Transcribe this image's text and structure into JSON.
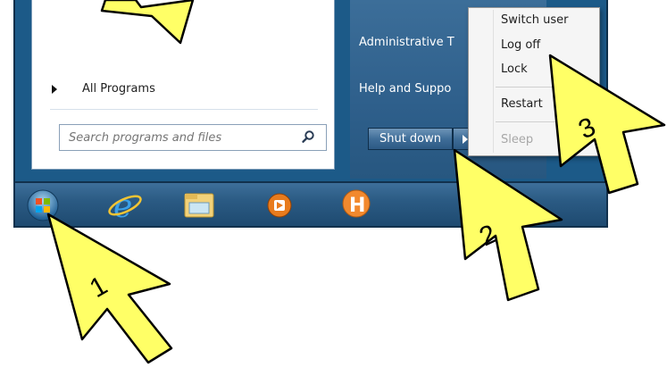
{
  "start_menu": {
    "all_programs_label": "All Programs",
    "search_placeholder": "Search programs and files",
    "right_items": {
      "administrative_tools": "Administrative T",
      "help_and_support": "Help and Suppo"
    },
    "shutdown_label": "Shut down"
  },
  "power_menu": {
    "switch_user": "Switch user",
    "log_off": "Log off",
    "lock": "Lock",
    "restart": "Restart",
    "sleep": "Sleep"
  },
  "taskbar": {
    "icons": [
      "windows-orb-icon",
      "internet-explorer-icon",
      "file-explorer-icon",
      "media-player-icon",
      "h-app-icon"
    ]
  },
  "callouts": {
    "one": "1",
    "two": "2",
    "three": "3"
  },
  "colors": {
    "callout_fill": "#ffff66",
    "taskbar": "#2b5b84",
    "right_pane": "#2e5f8b"
  }
}
